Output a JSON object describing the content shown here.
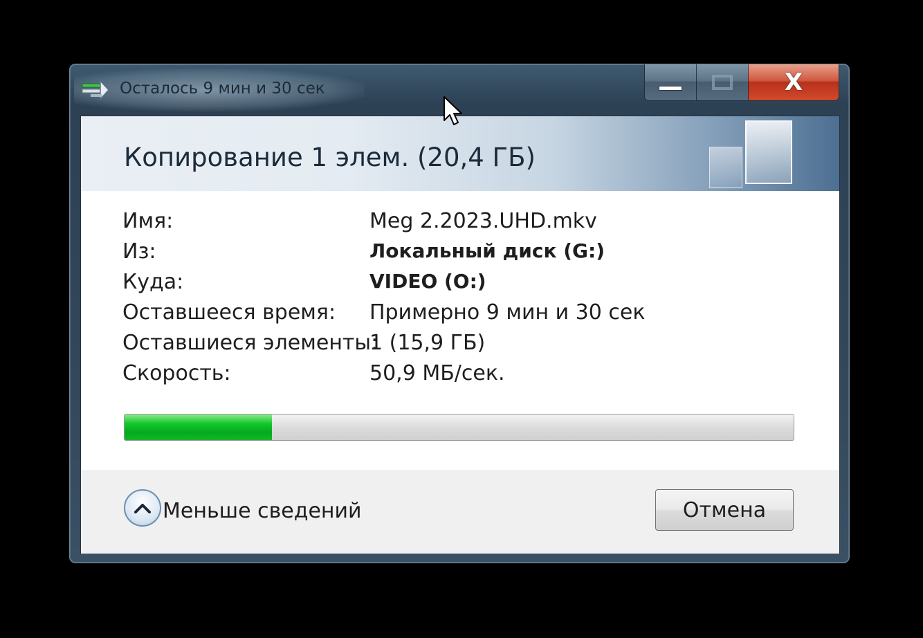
{
  "window": {
    "title": "Осталось 9 мин и 30 сек",
    "close_glyph": "X"
  },
  "header": {
    "title": "Копирование 1 элем. (20,4 ГБ)"
  },
  "details": [
    {
      "label": "Имя:",
      "value": "Meg 2.2023.UHD.mkv",
      "bold": false
    },
    {
      "label": "Из:",
      "value": "Локальный диск (G:)",
      "bold": true
    },
    {
      "label": "Куда:",
      "value": "VIDEO (O:)",
      "bold": true
    },
    {
      "label": "Оставшееся время:",
      "value": "Примерно 9 мин и 30 сек",
      "bold": false
    },
    {
      "label": "Оставшиеся элементы:",
      "value": "1 (15,9 ГБ)",
      "bold": false
    },
    {
      "label": "Скорость:",
      "value": "50,9 МБ/сек.",
      "bold": false
    }
  ],
  "progress": {
    "percent": 22,
    "color": "#14c82c"
  },
  "footer": {
    "less_details_label": "Меньше сведений",
    "cancel_label": "Отмена"
  },
  "icons": {
    "app": "copy-icon",
    "toggle": "chevron-up-icon",
    "cursor": "mouse-pointer-icon"
  }
}
